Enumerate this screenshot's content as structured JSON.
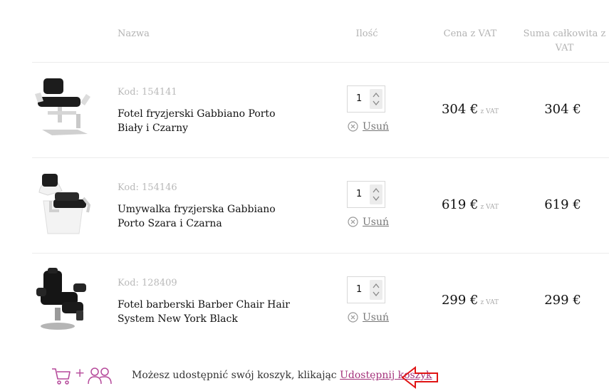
{
  "headers": {
    "name": "Nazwa",
    "qty": "Ilość",
    "price": "Cena z VAT",
    "total_line1": "Suma całkowita z",
    "total_line2": "VAT"
  },
  "items": [
    {
      "code": "Kod: 154141",
      "name": "Fotel fryzjerski Gabbiano Porto Biały i Czarny",
      "quantity": "1",
      "remove_label": "Usuń",
      "price": "304 €",
      "vat_suffix": "z VAT",
      "total": "304 €",
      "thumb_icon": "styling-chair-icon"
    },
    {
      "code": "Kod: 154146",
      "name": "Umywalka fryzjerska Gabbiano Porto Szara i Czarna",
      "quantity": "1",
      "remove_label": "Usuń",
      "price": "619 €",
      "vat_suffix": "z VAT",
      "total": "619 €",
      "thumb_icon": "shampoo-unit-icon"
    },
    {
      "code": "Kod: 128409",
      "name": "Fotel barberski Barber Chair Hair System New York Black",
      "quantity": "1",
      "remove_label": "Usuń",
      "price": "299 €",
      "vat_suffix": "z VAT",
      "total": "299 €",
      "thumb_icon": "barber-chair-icon"
    }
  ],
  "share": {
    "text": "Możesz udostępnić swój koszyk, klikając ",
    "link_label": "Udostępnij koszyk",
    "plus": "+"
  },
  "colors": {
    "accent": "#a4327b",
    "muted_text": "#b3b3b3",
    "arrow": "#e01414"
  }
}
